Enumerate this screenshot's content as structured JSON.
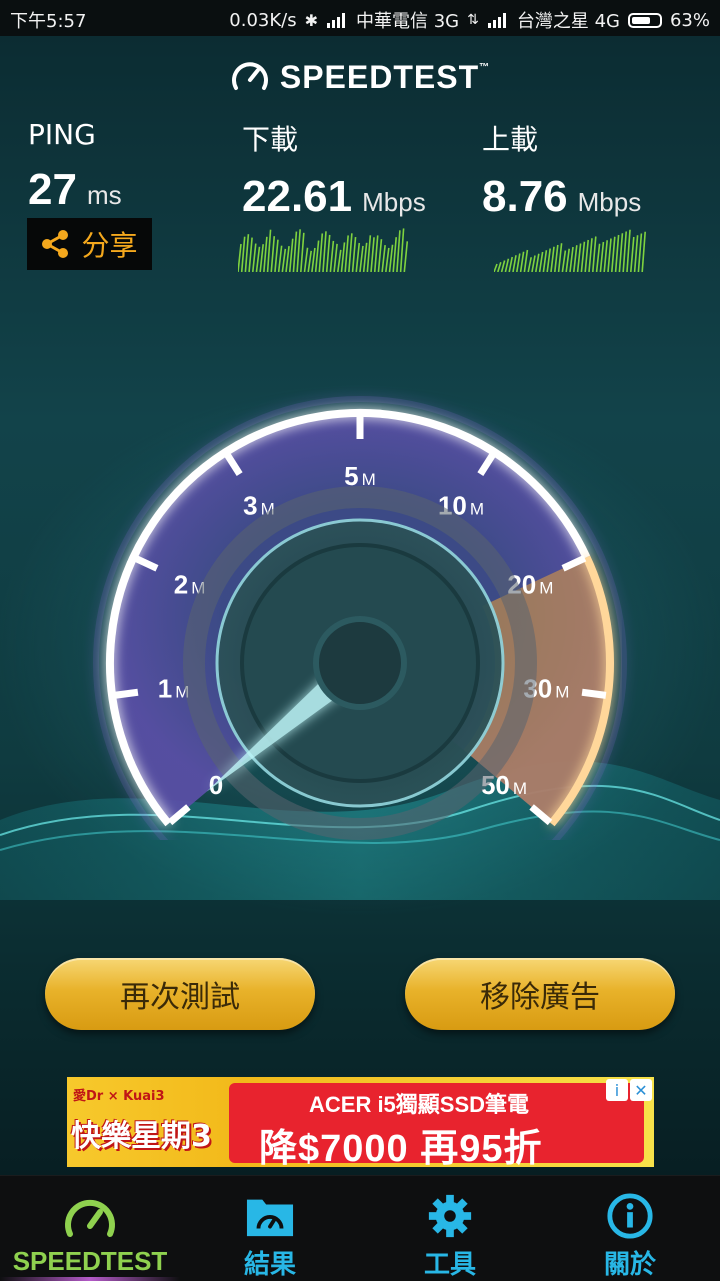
{
  "status_bar": {
    "time": "下午5:57",
    "net_speed": "0.03K/s",
    "carrier1": "中華電信 3G",
    "carrier2": "台灣之星 4G",
    "battery": "63%"
  },
  "app": {
    "title": "SPEEDTEST",
    "trademark": "™"
  },
  "results": {
    "ping": {
      "label": "PING",
      "value": "27",
      "unit": "ms"
    },
    "download": {
      "label": "下載",
      "value": "22.61",
      "unit": "Mbps"
    },
    "upload": {
      "label": "上載",
      "value": "8.76",
      "unit": "Mbps"
    }
  },
  "share": {
    "label": "分享",
    "icon": "share-icon"
  },
  "gauge": {
    "ticks": [
      {
        "num": "0",
        "unit": ""
      },
      {
        "num": "1",
        "unit": "M"
      },
      {
        "num": "2",
        "unit": "M"
      },
      {
        "num": "3",
        "unit": "M"
      },
      {
        "num": "5",
        "unit": "M"
      },
      {
        "num": "10",
        "unit": "M"
      },
      {
        "num": "20",
        "unit": "M"
      },
      {
        "num": "30",
        "unit": "M"
      },
      {
        "num": "50",
        "unit": "M"
      }
    ],
    "needle_value": "0",
    "colors": {
      "ring": "#c9a6ff",
      "accent": "#e8a13a"
    }
  },
  "buttons": {
    "retest": "再次測試",
    "remove_ads": "移除廣告"
  },
  "ad": {
    "brand": "愛Dr × Kuai3",
    "slogan": "快樂星期3",
    "line1": "ACER i5獨顯SSD筆電",
    "line2": "降$7000 再95折",
    "info": "i",
    "close": "✕"
  },
  "nav": {
    "items": [
      {
        "label": "SPEEDTEST",
        "icon": "speedometer-icon",
        "color": "#8fd14f",
        "active": true
      },
      {
        "label": "結果",
        "icon": "folder-gauge-icon",
        "color": "#28b7e6"
      },
      {
        "label": "工具",
        "icon": "gear-icon",
        "color": "#28b7e6"
      },
      {
        "label": "關於",
        "icon": "info-icon",
        "color": "#28b7e6"
      }
    ]
  }
}
